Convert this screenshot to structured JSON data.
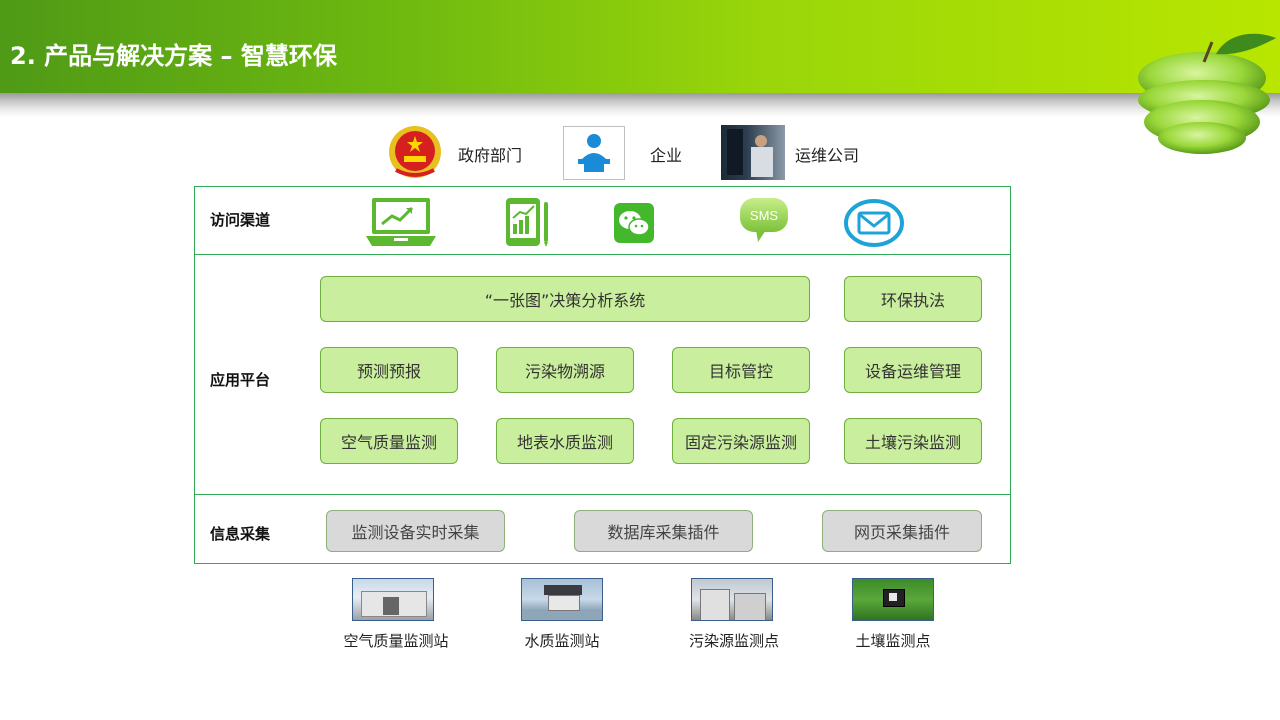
{
  "header": {
    "title": "2. 产品与解决方案 – 智慧环保"
  },
  "actors": [
    {
      "label": "政府部门",
      "icon": "national-emblem-icon"
    },
    {
      "label": "企业",
      "icon": "business-person-icon"
    },
    {
      "label": "运维公司",
      "icon": "technician-photo"
    }
  ],
  "rows": {
    "access": {
      "label": "访问渠道",
      "channels": [
        "laptop-chart-icon",
        "tablet-chart-icon",
        "wechat-icon",
        "sms-icon",
        "email-icon"
      ],
      "sms_text": "SMS"
    },
    "app": {
      "label": "应用平台",
      "items": [
        [
          "“一张图”决策分析系统",
          "环保执法"
        ],
        [
          "预测预报",
          "污染物溯源",
          "目标管控",
          "设备运维管理"
        ],
        [
          "空气质量监测",
          "地表水质监测",
          "固定污染源监测",
          "土壤污染监测"
        ]
      ]
    },
    "collect": {
      "label": "信息采集",
      "items": [
        "监测设备实时采集",
        "数据库采集插件",
        "网页采集插件"
      ]
    }
  },
  "stations": [
    "空气质量监测站",
    "水质监测站",
    "污染源监测点",
    "土壤监测点"
  ],
  "colors": {
    "frame": "#2faa55",
    "box_fill": "#c9ee9d",
    "gray_fill": "#d9d9d9",
    "header_dark": "#4f9a16",
    "header_light": "#b8e600"
  }
}
